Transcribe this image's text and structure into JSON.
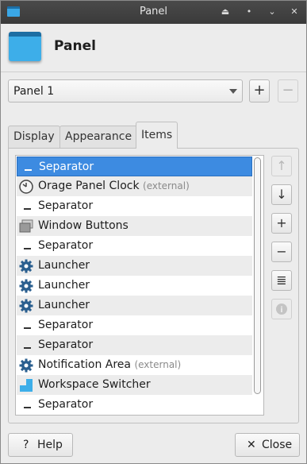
{
  "window": {
    "title": "Panel",
    "controls": {
      "shade": "⏏",
      "minimize": "•",
      "maximize": "⌄",
      "close": "✕"
    }
  },
  "header": {
    "heading": "Panel"
  },
  "panel_select": {
    "value": "Panel 1",
    "add_label": "+",
    "remove_label": "−"
  },
  "tabs": [
    {
      "label": "Display"
    },
    {
      "label": "Appearance"
    },
    {
      "label": "Items"
    }
  ],
  "active_tab": "Items",
  "items": [
    {
      "name": "Separator",
      "extra": "",
      "icon": "separator-icon"
    },
    {
      "name": "Orage Panel Clock",
      "extra": "(external)",
      "icon": "clock-icon"
    },
    {
      "name": "Separator",
      "extra": "",
      "icon": "separator-icon"
    },
    {
      "name": "Window Buttons",
      "extra": "",
      "icon": "window-buttons-icon"
    },
    {
      "name": "Separator",
      "extra": "",
      "icon": "separator-icon"
    },
    {
      "name": "Launcher",
      "extra": "",
      "icon": "gear-icon"
    },
    {
      "name": "Launcher",
      "extra": "",
      "icon": "gear-icon"
    },
    {
      "name": "Launcher",
      "extra": "",
      "icon": "gear-icon"
    },
    {
      "name": "Separator",
      "extra": "",
      "icon": "separator-icon"
    },
    {
      "name": "Separator",
      "extra": "",
      "icon": "separator-icon"
    },
    {
      "name": "Notification Area",
      "extra": "(external)",
      "icon": "gear-icon"
    },
    {
      "name": "Workspace Switcher",
      "extra": "",
      "icon": "workspace-icon"
    },
    {
      "name": "Separator",
      "extra": "",
      "icon": "separator-icon"
    }
  ],
  "selected_index": 0,
  "side_buttons": {
    "up": "↑",
    "down": "↓",
    "add": "+",
    "remove": "−",
    "edit": "≣",
    "about": "i"
  },
  "footer": {
    "help_label": "Help",
    "help_icon": "?",
    "close_label": "Close",
    "close_icon": "✕"
  },
  "colors": {
    "selection": "#3d8be1",
    "accent": "#3daee9"
  }
}
